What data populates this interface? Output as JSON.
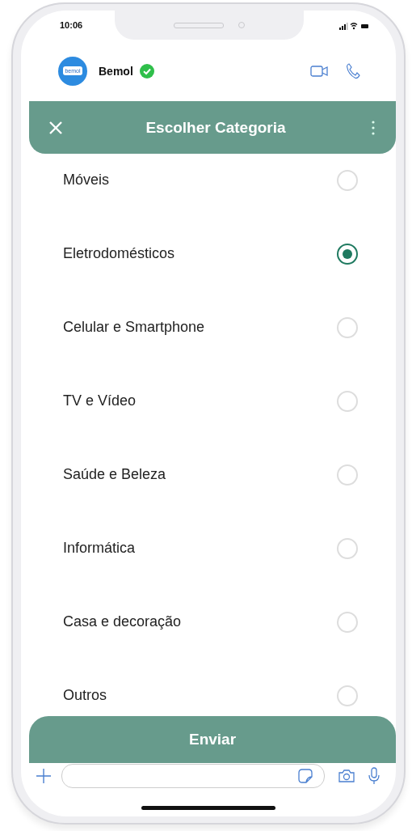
{
  "status_bar": {
    "time": "10:06"
  },
  "chat": {
    "avatar_text": "bemol",
    "name": "Bemol",
    "verified": true
  },
  "sheet": {
    "title": "Escolher Categoria",
    "options": [
      {
        "label": "Móveis",
        "selected": false
      },
      {
        "label": "Eletrodomésticos",
        "selected": true
      },
      {
        "label": "Celular e Smartphone",
        "selected": false
      },
      {
        "label": "TV e Vídeo",
        "selected": false
      },
      {
        "label": "Saúde e Beleza",
        "selected": false
      },
      {
        "label": "Informática",
        "selected": false
      },
      {
        "label": "Casa e decoração",
        "selected": false
      },
      {
        "label": "Outros",
        "selected": false
      }
    ]
  },
  "send_button": "Enviar"
}
